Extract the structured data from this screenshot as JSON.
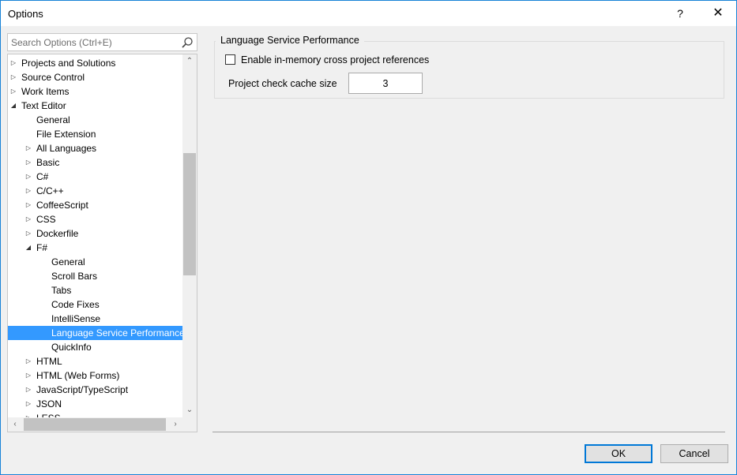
{
  "window": {
    "title": "Options",
    "help_label": "?",
    "close_label": "✕"
  },
  "search": {
    "placeholder": "Search Options (Ctrl+E)"
  },
  "tree": {
    "items": [
      {
        "label": "Projects and Solutions",
        "expander": "collapsed"
      },
      {
        "label": "Source Control",
        "expander": "collapsed"
      },
      {
        "label": "Work Items",
        "expander": "collapsed"
      },
      {
        "label": "Text Editor",
        "expander": "expanded"
      },
      {
        "label": "General",
        "expander": "none"
      },
      {
        "label": "File Extension",
        "expander": "none"
      },
      {
        "label": "All Languages",
        "expander": "collapsed"
      },
      {
        "label": "Basic",
        "expander": "collapsed"
      },
      {
        "label": "C#",
        "expander": "collapsed"
      },
      {
        "label": "C/C++",
        "expander": "collapsed"
      },
      {
        "label": "CoffeeScript",
        "expander": "collapsed"
      },
      {
        "label": "CSS",
        "expander": "collapsed"
      },
      {
        "label": "Dockerfile",
        "expander": "collapsed"
      },
      {
        "label": "F#",
        "expander": "expanded"
      },
      {
        "label": "General",
        "expander": "none"
      },
      {
        "label": "Scroll Bars",
        "expander": "none"
      },
      {
        "label": "Tabs",
        "expander": "none"
      },
      {
        "label": "Code Fixes",
        "expander": "none"
      },
      {
        "label": "IntelliSense",
        "expander": "none"
      },
      {
        "label": "Language Service Performance",
        "expander": "none",
        "selected": true
      },
      {
        "label": "QuickInfo",
        "expander": "none"
      },
      {
        "label": "HTML",
        "expander": "collapsed"
      },
      {
        "label": "HTML (Web Forms)",
        "expander": "collapsed"
      },
      {
        "label": "JavaScript/TypeScript",
        "expander": "collapsed"
      },
      {
        "label": "JSON",
        "expander": "collapsed"
      },
      {
        "label": "LESS",
        "expander": "collapsed"
      }
    ]
  },
  "panel": {
    "group_title": "Language Service Performance",
    "checkbox_label": "Enable in-memory cross project references",
    "checkbox_checked": false,
    "cache_label": "Project check cache size",
    "cache_value": "3"
  },
  "buttons": {
    "ok": "OK",
    "cancel": "Cancel"
  },
  "icons": {
    "search": "search-icon",
    "expanded": "expanded-arrow-icon",
    "collapsed": "collapsed-arrow-icon"
  },
  "colors": {
    "selection": "#3399ff",
    "accent": "#0078d7"
  }
}
